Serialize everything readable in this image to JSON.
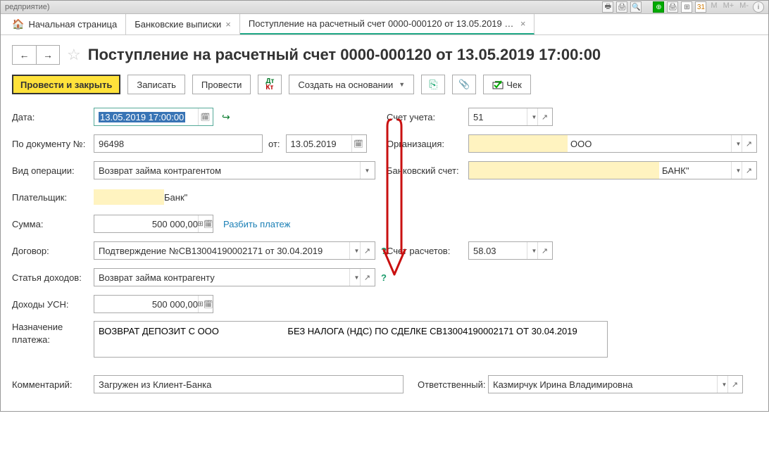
{
  "titlebar": {
    "text": "редприятие)"
  },
  "tabs": [
    {
      "icon": "🏠",
      "label": "Начальная страница",
      "closable": false
    },
    {
      "label": "Банковские выписки",
      "closable": true
    },
    {
      "label": "Поступление на расчетный счет 0000-000120 от 13.05.2019 17:00:00",
      "closable": true,
      "active": true
    }
  ],
  "title": "Поступление на расчетный счет 0000-000120 от 13.05.2019 17:00:00",
  "toolbar": {
    "post_close": "Провести и закрыть",
    "write": "Записать",
    "post": "Провести",
    "create_based": "Создать на основании",
    "cheque": "Чек"
  },
  "labels": {
    "date": "Дата:",
    "doc_no": "По документу №:",
    "doc_from": "от:",
    "op_kind": "Вид операции:",
    "payer": "Плательщик:",
    "amount": "Сумма:",
    "split": "Разбить платеж",
    "contract": "Договор:",
    "income_item": "Статья доходов:",
    "usn_income": "Доходы УСН:",
    "purpose": "Назначение платежа:",
    "comment": "Комментарий:",
    "account": "Счет учета:",
    "org": "Организация:",
    "bank_acct": "Банковский счет:",
    "settle_acct": "Счет расчетов:",
    "responsible": "Ответственный:"
  },
  "values": {
    "date": "13.05.2019 17:00:00",
    "doc_no": "96498",
    "doc_date": "13.05.2019",
    "op_kind": "Возврат займа контрагентом",
    "payer": "Банк\"",
    "amount": "500 000,00",
    "contract": "Подтверждение №СВ13004190002171 от 30.04.2019",
    "income_item": "Возврат займа контрагенту",
    "usn_income": "500 000,00",
    "purpose": "ВОЗВРАТ ДЕПОЗИТ С ООО                           БЕЗ НАЛОГА (НДС) ПО СДЕЛКЕ СВ13004190002171 ОТ 30.04.2019",
    "comment": "Загружен из Клиент-Банка",
    "account": "51",
    "org": "ООО",
    "bank_acct": "БАНК\"",
    "settle_acct": "58.03",
    "responsible": "Казмирчук Ирина Владимировна"
  }
}
